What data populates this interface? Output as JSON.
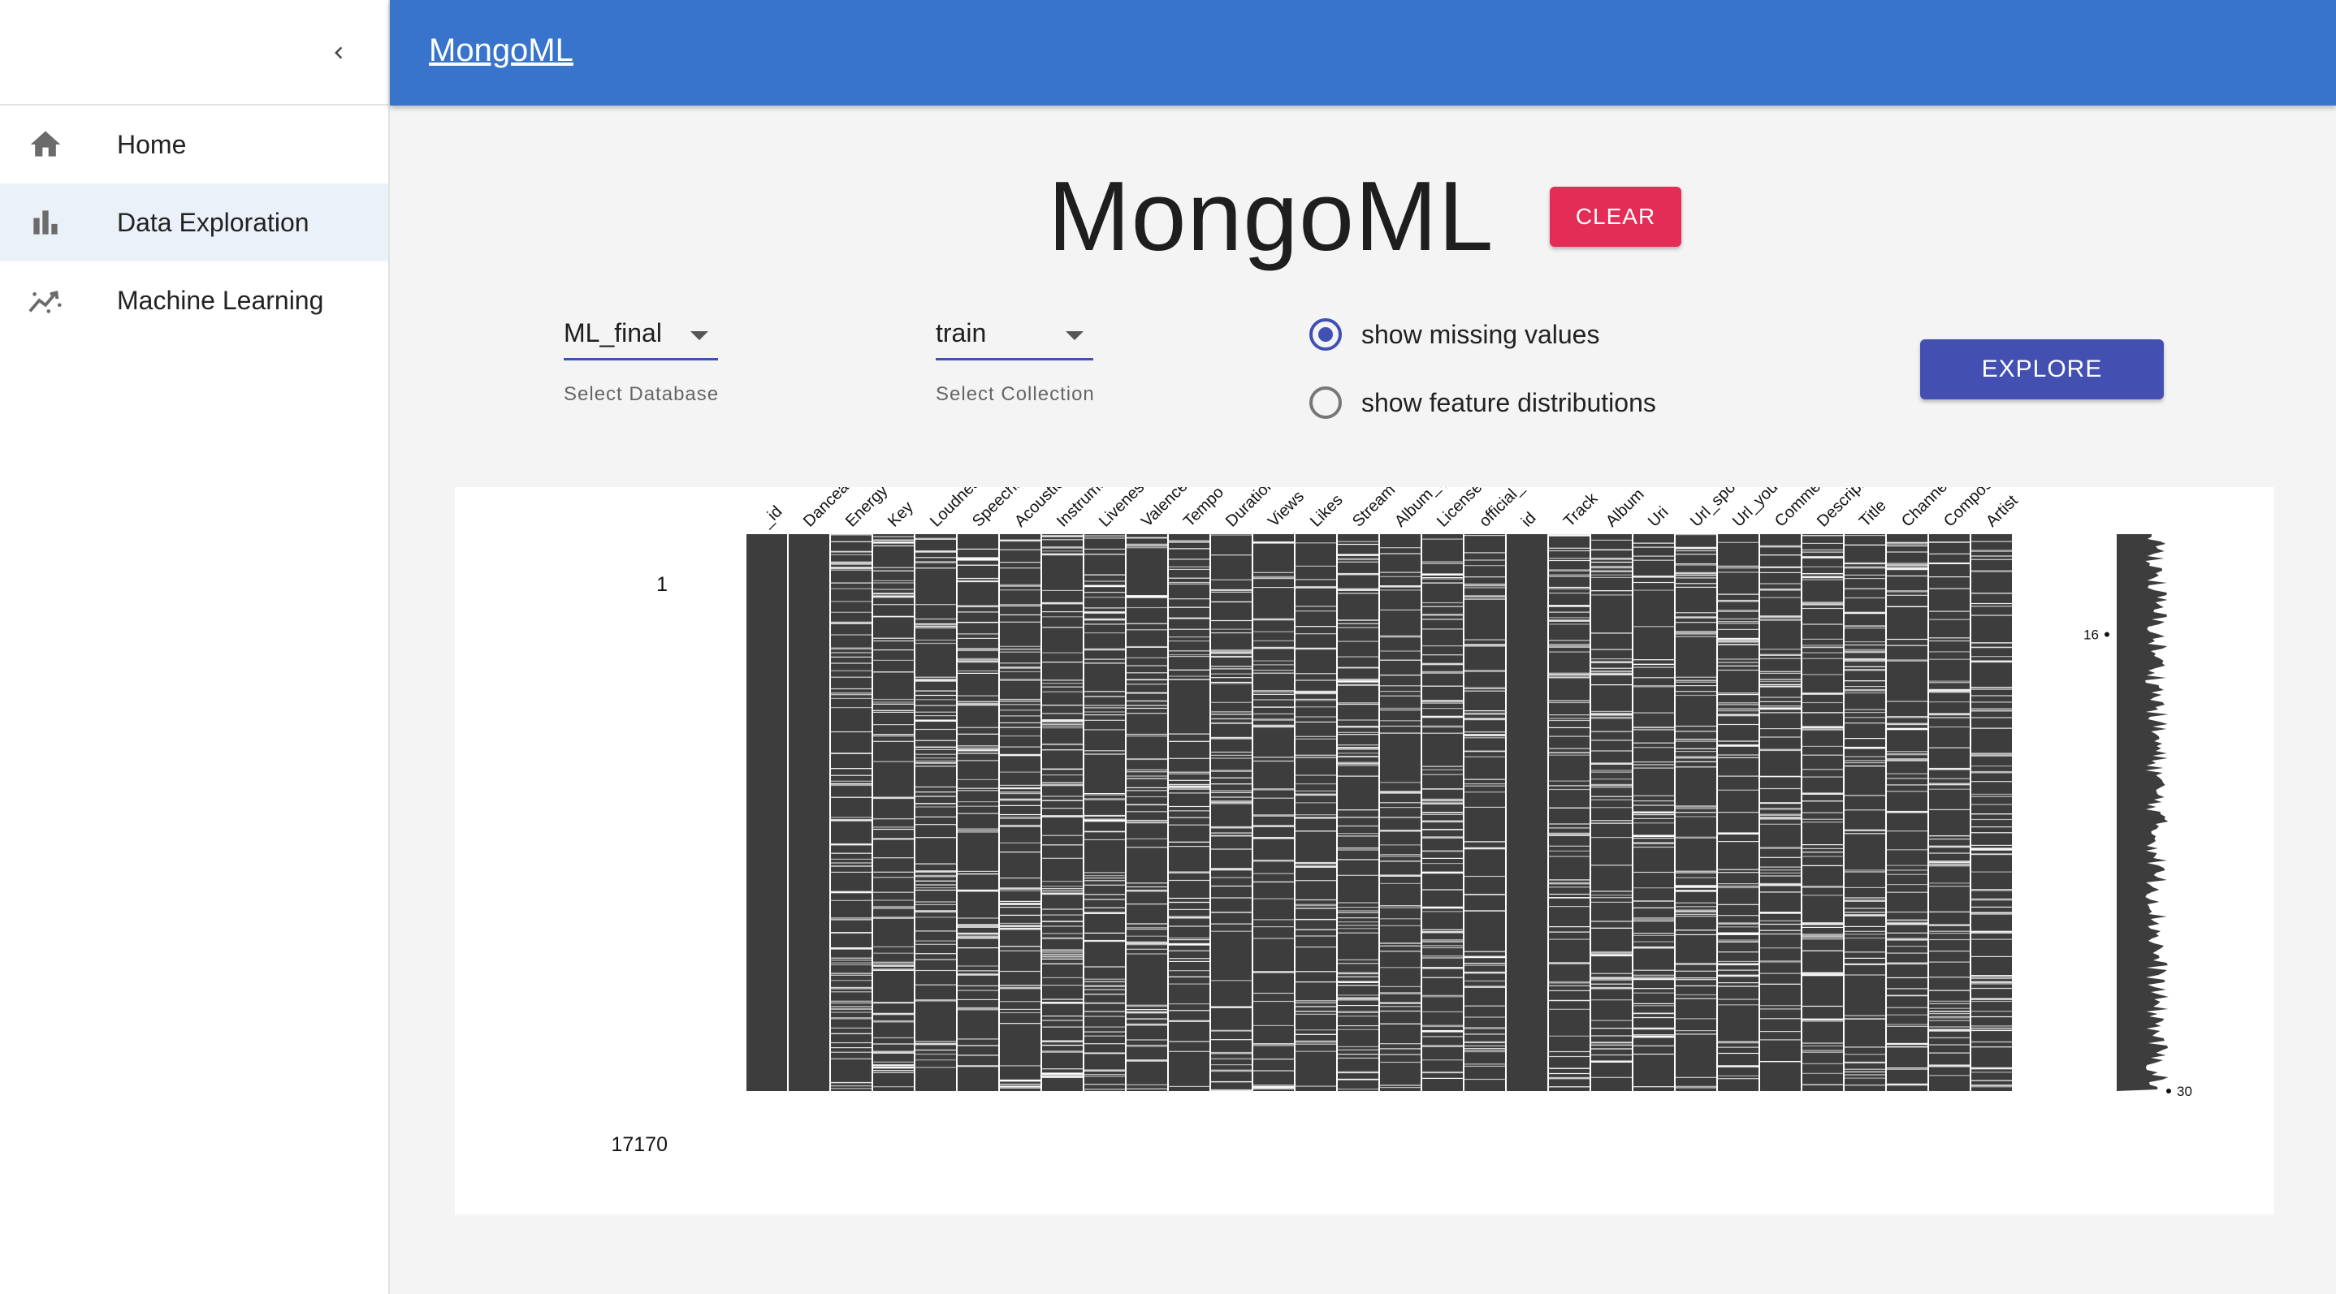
{
  "appbar": {
    "title": "MongoML"
  },
  "sidebar": {
    "items": [
      {
        "label": "Home",
        "icon": "home-icon",
        "active": false
      },
      {
        "label": "Data Exploration",
        "icon": "bar-chart-icon",
        "active": true
      },
      {
        "label": "Machine Learning",
        "icon": "trending-icon",
        "active": false
      }
    ]
  },
  "main": {
    "title": "MongoML",
    "clear_label": "CLEAR",
    "database_select": {
      "value": "ML_final",
      "helper": "Select Database"
    },
    "collection_select": {
      "value": "train",
      "helper": "Select Collection"
    },
    "options": [
      {
        "label": "show missing values",
        "checked": true
      },
      {
        "label": "show feature distributions",
        "checked": false
      }
    ],
    "explore_label": "EXPLORE"
  },
  "colors": {
    "appbar": "#3874cb",
    "clear": "#e32c56",
    "explore": "#4350b2",
    "matrix_fill": "#3d3d3d"
  },
  "chart_data": {
    "type": "heatmap",
    "columns": [
      "_id",
      "Danceability",
      "Energy",
      "Key",
      "Loudness",
      "Speechiness",
      "Acousticness",
      "Instrumentalness",
      "Liveness",
      "Valence",
      "Tempo",
      "Duration_ms",
      "Views",
      "Likes",
      "Stream",
      "Album_type",
      "Licensed",
      "official_video",
      "id",
      "Track",
      "Album",
      "Uri",
      "Url_spotify",
      "Url_youtube",
      "Comments",
      "Description",
      "Title",
      "Channel",
      "Composer",
      "Artist"
    ],
    "missing_density": [
      0,
      0,
      0.35,
      0.3,
      0.33,
      0.3,
      0.32,
      0.34,
      0.33,
      0.31,
      0.3,
      0.3,
      0.22,
      0.25,
      0.35,
      0.24,
      0.3,
      0.28,
      0,
      0.32,
      0.32,
      0.3,
      0.3,
      0.32,
      0.3,
      0.28,
      0.32,
      0.28,
      0.3,
      0.34
    ],
    "row_range_labels": [
      "1",
      "17170"
    ],
    "row_completeness_labels": [
      {
        "label": "16",
        "at": 0.18
      },
      {
        "label": "30",
        "at": 1.0
      }
    ]
  }
}
